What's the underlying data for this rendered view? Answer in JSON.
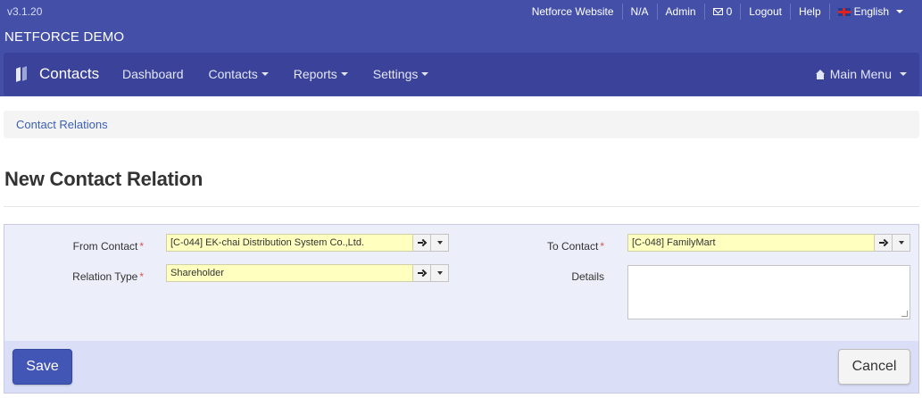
{
  "app": {
    "version": "v3.1.20",
    "company": "NETFORCE DEMO"
  },
  "top_links": {
    "website": "Netforce Website",
    "na": "N/A",
    "admin": "Admin",
    "inbox_count": "0",
    "logout": "Logout",
    "help": "Help",
    "language": "English"
  },
  "navbar": {
    "brand": "Contacts",
    "items": [
      {
        "label": "Dashboard",
        "dropdown": false
      },
      {
        "label": "Contacts",
        "dropdown": true
      },
      {
        "label": "Reports",
        "dropdown": true
      },
      {
        "label": "Settings",
        "dropdown": true
      }
    ],
    "main_menu": "Main Menu"
  },
  "breadcrumb": {
    "link": "Contact Relations"
  },
  "page": {
    "title": "New Contact Relation"
  },
  "form": {
    "from_contact": {
      "label": "From Contact",
      "value": "[C-044] EK-chai Distribution System Co.,Ltd."
    },
    "relation_type": {
      "label": "Relation Type",
      "value": "Shareholder"
    },
    "to_contact": {
      "label": "To Contact",
      "value": "[C-048] FamilyMart"
    },
    "details": {
      "label": "Details",
      "value": ""
    },
    "required_mark": "*"
  },
  "actions": {
    "save": "Save",
    "cancel": "Cancel"
  },
  "colors": {
    "header_bg": "#4450a8",
    "navbar_bg": "#3a4399",
    "primary_button": "#4156b5",
    "m2o_field_bg": "#ffffbf",
    "form_bg": "#eceef9"
  }
}
